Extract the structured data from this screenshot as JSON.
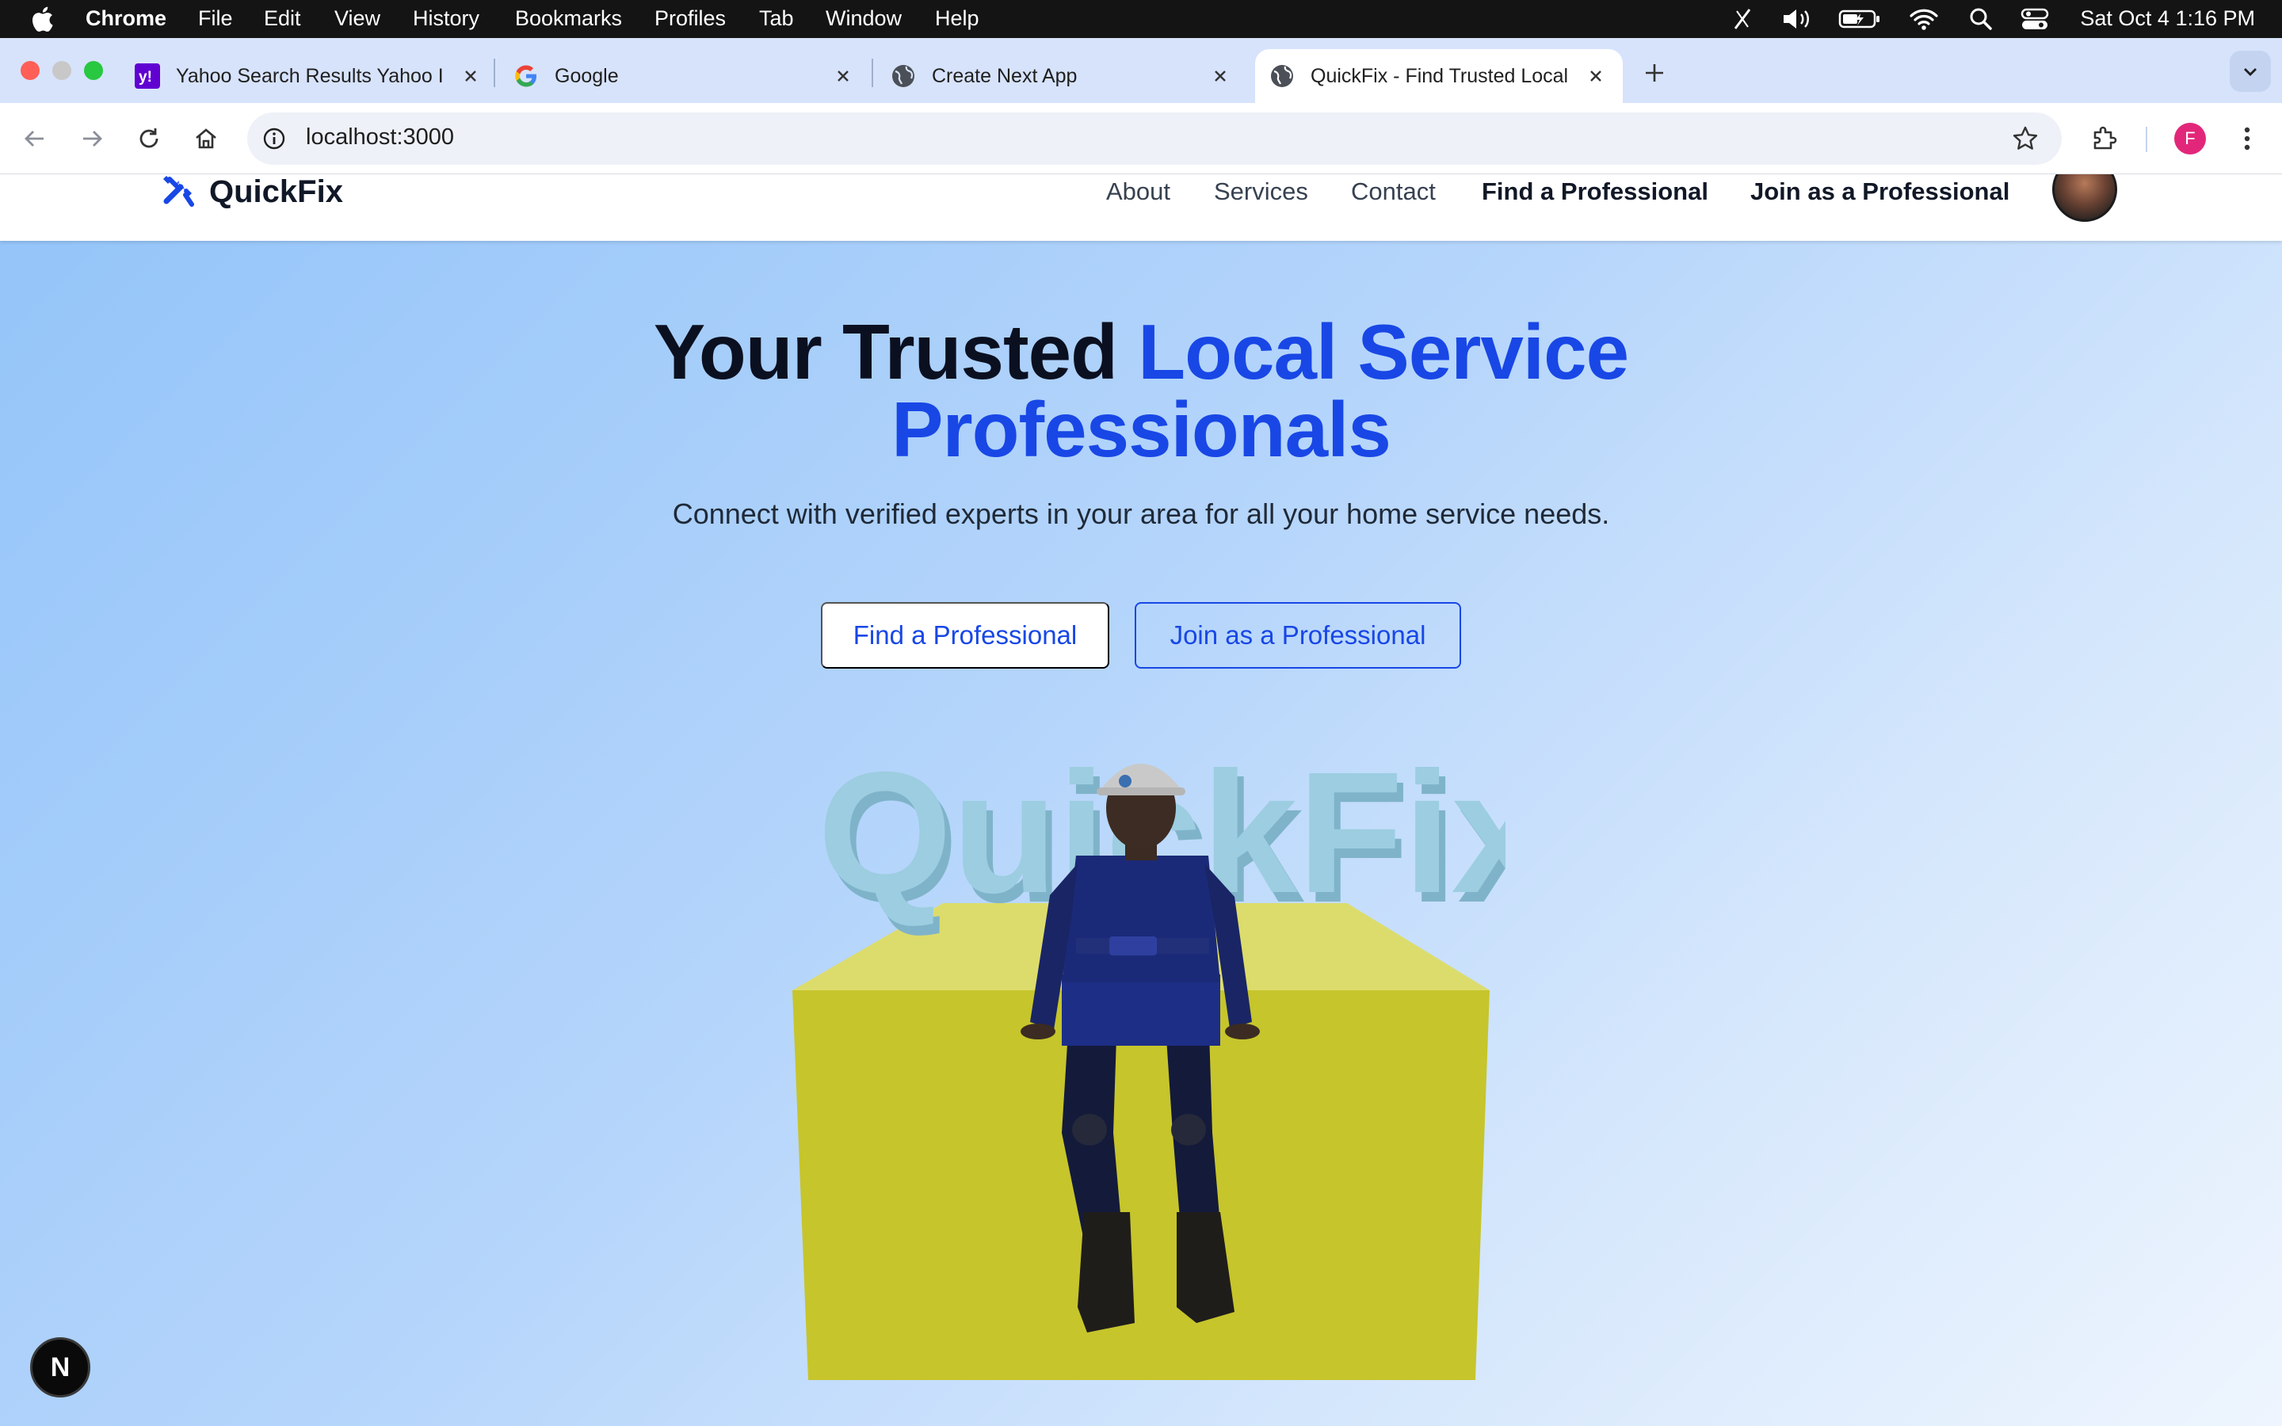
{
  "os_menubar": {
    "app_name": "Chrome",
    "menus": [
      "File",
      "Edit",
      "View",
      "History",
      "Bookmarks",
      "Profiles",
      "Tab",
      "Window",
      "Help"
    ],
    "clock": "Sat Oct 4  1:16 PM"
  },
  "browser": {
    "tabs": [
      {
        "title": "Yahoo Search Results Yahoo I",
        "icon": "yahoo-icon",
        "active": false
      },
      {
        "title": "Google",
        "icon": "google-icon",
        "active": false
      },
      {
        "title": "Create Next App",
        "icon": "globe-icon",
        "active": false
      },
      {
        "title": "QuickFix - Find Trusted Local",
        "icon": "globe-icon",
        "active": true
      }
    ],
    "url": "localhost:3000",
    "profile_initial": "F"
  },
  "site": {
    "brand": "QuickFix",
    "nav": {
      "about": "About",
      "services": "Services",
      "contact": "Contact",
      "find": "Find a Professional",
      "join": "Join as a Professional"
    },
    "hero": {
      "title_plain": "Your Trusted",
      "title_accent_line1": "Local Service",
      "title_accent_line2": "Professionals",
      "subtitle": "Connect with verified experts in your area for all your home service needs.",
      "primary_cta": "Find a Professional",
      "secondary_cta": "Join as a Professional",
      "scene_text": "QuickFix"
    },
    "dev_badge": "N"
  },
  "colors": {
    "accent_blue": "#1847e6",
    "menubar": "#141414",
    "tabstrip": "#d7e3fb",
    "platform_yellow": "#c8c72f",
    "scene_letters": "#8fc3d9"
  }
}
